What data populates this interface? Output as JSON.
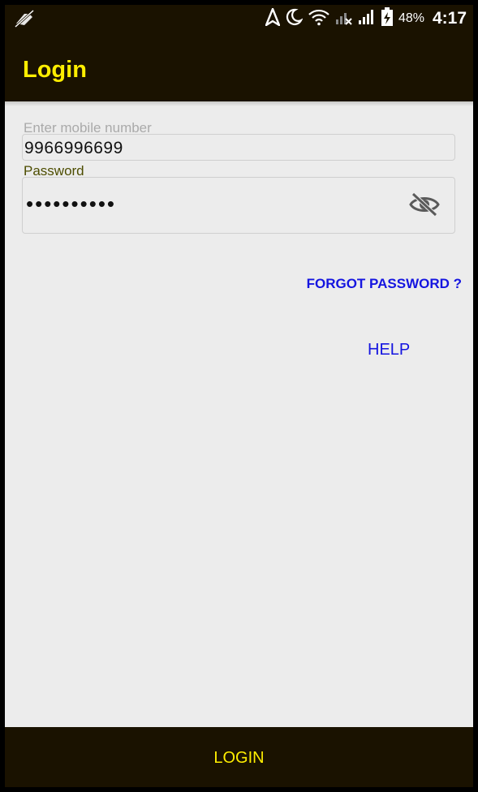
{
  "status_bar": {
    "battery": "48%",
    "time": "4:17",
    "icons": [
      "no-sim-icon",
      "navigation-icon",
      "moon-icon",
      "wifi-icon",
      "signal-off-icon",
      "signal-icon",
      "battery-charging-icon"
    ]
  },
  "appbar": {
    "title": "Login"
  },
  "form": {
    "mobile_label": "Enter mobile number",
    "mobile_value": "9966996699",
    "password_label": "Password",
    "password_value": "••••••••••",
    "visibility_icon": "eye-off-icon"
  },
  "links": {
    "forgot": "FORGOT PASSWORD ?",
    "help": "HELP"
  },
  "footer": {
    "login_label": "LOGIN"
  },
  "colors": {
    "bar": "#1a1200",
    "accent": "#ffee00",
    "link": "#1515e0",
    "background": "#ececec"
  }
}
